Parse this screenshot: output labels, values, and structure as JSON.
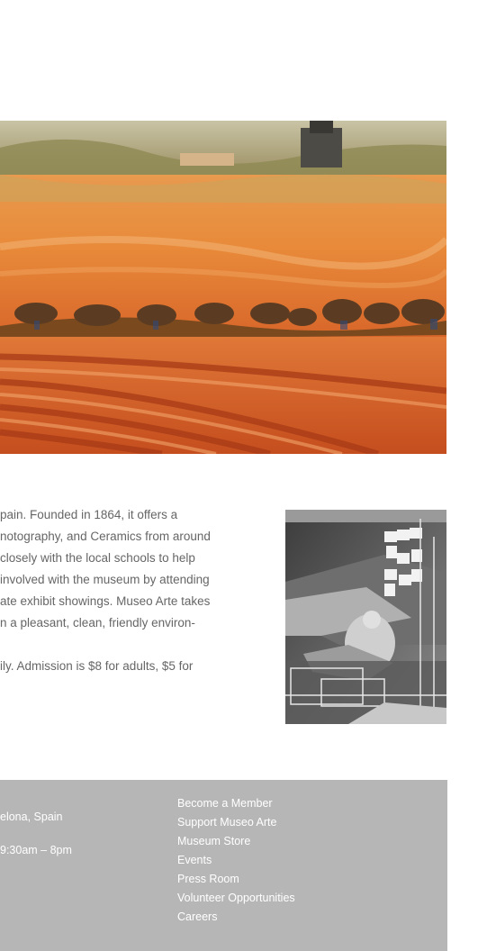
{
  "intro": {
    "lines": [
      "pain. Founded in 1864, it offers a",
      "notography, and Ceramics from around",
      "closely with the local schools to help",
      "involved with the museum by attending",
      "ate exhibit showings. Museo Arte takes",
      "n a pleasant, clean, friendly environ-"
    ],
    "admission": "ily. Admission is $8 for adults, $5 for"
  },
  "footer": {
    "address": "elona, Spain",
    "hours": "9:30am – 8pm",
    "links": [
      "Become a Member",
      "Support Museo Arte",
      "Museum Store",
      "Events",
      "Press Room",
      "Volunteer Opportunities",
      "Careers"
    ]
  },
  "images": {
    "hero": "watercolor-landscape-painting",
    "side": "grayscale-collage-artwork"
  }
}
